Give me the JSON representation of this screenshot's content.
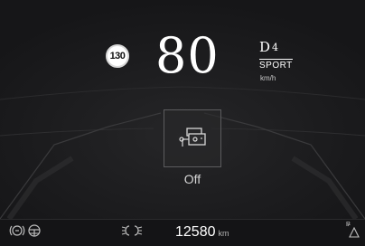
{
  "speed_limit": {
    "value": "130"
  },
  "speedometer": {
    "value": "80",
    "unit": "km/h"
  },
  "gearbox": {
    "gear_letter": "D",
    "gear_number": "4",
    "mode": "SPORT"
  },
  "function_panel": {
    "icon": "parking-sensors-icon",
    "status": "Off"
  },
  "bottom_bar": {
    "odometer_value": "12580",
    "odometer_unit": "km",
    "indicators": [
      "brake-system-icon",
      "steering-icon",
      "position-lights-icon",
      "parking-assist-icon"
    ],
    "parking_assist_label": "P"
  },
  "colors": {
    "background": "#1b1b1d",
    "text": "#ffffff",
    "muted": "#c9c9c9"
  }
}
